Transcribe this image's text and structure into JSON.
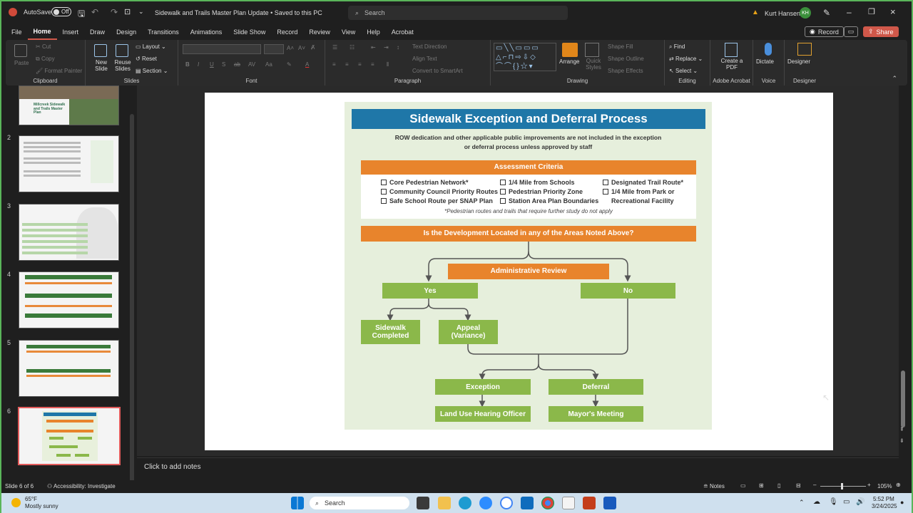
{
  "titlebar": {
    "autosave_label": "AutoSave",
    "autosave_state": "Off",
    "doc_title": "Sidewalk and Trails Master Plan Update • Saved to this PC",
    "search_placeholder": "Search",
    "user_name": "Kurt Hansen",
    "user_initials": "KH"
  },
  "menu": {
    "items": [
      "File",
      "Home",
      "Insert",
      "Draw",
      "Design",
      "Transitions",
      "Animations",
      "Slide Show",
      "Record",
      "Review",
      "View",
      "Help",
      "Acrobat"
    ],
    "record_button": "Record",
    "share_button": "Share"
  },
  "ribbon": {
    "clipboard": {
      "paste": "Paste",
      "cut": "Cut",
      "copy": "Copy",
      "format_painter": "Format Painter",
      "label": "Clipboard"
    },
    "slides": {
      "new_slide": "New Slide",
      "reuse_slides": "Reuse Slides",
      "layout": "Layout",
      "reset": "Reset",
      "section": "Section",
      "label": "Slides"
    },
    "font": {
      "label": "Font"
    },
    "paragraph": {
      "text_direction": "Text Direction",
      "align_text": "Align Text",
      "smartart": "Convert to SmartArt",
      "label": "Paragraph"
    },
    "drawing": {
      "arrange": "Arrange",
      "quick_styles": "Quick Styles",
      "shape_fill": "Shape Fill",
      "shape_outline": "Shape Outline",
      "shape_effects": "Shape Effects",
      "label": "Drawing"
    },
    "editing": {
      "find": "Find",
      "replace": "Replace",
      "select": "Select",
      "label": "Editing"
    },
    "acrobat": {
      "create_pdf": "Create a PDF",
      "label": "Adobe Acrobat"
    },
    "voice": {
      "dictate": "Dictate",
      "label": "Voice"
    },
    "designer": {
      "designer": "Designer",
      "label": "Designer"
    }
  },
  "thumbnails": {
    "numbers": [
      "2",
      "3",
      "4",
      "5",
      "6"
    ],
    "first_slide_text": "Millcreek Sidewalk and Trails Master Plan"
  },
  "slide": {
    "title": "Sidewalk Exception and Deferral Process",
    "subtitle_line1": "ROW dedication and other applicable public improvements are not included in the exception",
    "subtitle_line2": "or deferral process unless approved by staff",
    "assessment_header": "Assessment Criteria",
    "criteria_col1": [
      "Core Pedestrian Network*",
      "Community Council Priority Routes",
      "Safe School Route per SNAP Plan"
    ],
    "criteria_col2": [
      "1/4 Mile from Schools",
      "Pedestrian Priority Zone",
      "Station Area Plan Boundaries"
    ],
    "criteria_col3": [
      "Designated Trail Route*",
      "1/4 Mile from Park or",
      "Recreational Facility"
    ],
    "footnote": "*Pedestrian routes and trails that require further study do not apply",
    "question": "Is the Development Located in any of the Areas Noted Above?",
    "admin_review": "Administrative Review",
    "yes": "Yes",
    "no": "No",
    "sidewalk_completed_1": "Sidewalk",
    "sidewalk_completed_2": "Completed",
    "appeal_1": "Appeal",
    "appeal_2": "(Variance)",
    "exception": "Exception",
    "deferral": "Deferral",
    "land_use": "Land Use Hearing Officer",
    "mayors_meeting": "Mayor's Meeting"
  },
  "notes_placeholder": "Click to add notes",
  "status": {
    "slide_counter": "Slide 6 of 6",
    "accessibility": "Accessibility: Investigate",
    "notes": "Notes",
    "zoom": "105%"
  },
  "taskbar": {
    "weather_temp": "65°F",
    "weather_desc": "Mostly sunny",
    "search": "Search",
    "time": "5:52 PM",
    "date": "3/24/2025"
  }
}
